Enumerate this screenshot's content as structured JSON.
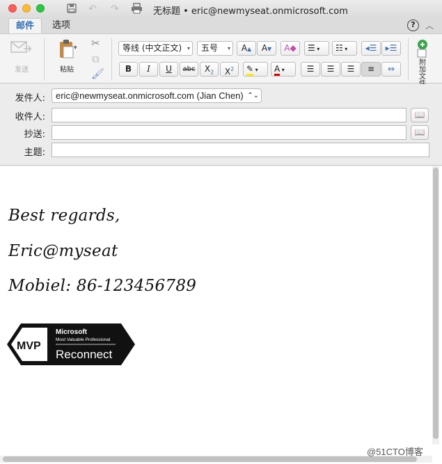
{
  "window": {
    "title": "无标题 • eric@newmyseat.onmicrosoft.com"
  },
  "tabs": [
    {
      "label": "邮件"
    },
    {
      "label": "选项"
    }
  ],
  "help_label": "?",
  "ribbon": {
    "send_label": "发送",
    "paste_label": "粘贴",
    "font_name": "等线 (中文正文)",
    "font_size": "五号",
    "attach_label": "附加文件"
  },
  "fields": {
    "from_label": "发件人:",
    "from_value": "eric@newmyseat.onmicrosoft.com (Jian Chen)",
    "to_label": "收件人:",
    "to_value": "",
    "cc_label": "抄送:",
    "cc_value": "",
    "subject_label": "主题:",
    "subject_value": ""
  },
  "body": {
    "signature_line1": "Best regards,",
    "signature_line2": "Eric@myseat",
    "signature_line3": "Mobiel: 86-123456789",
    "mvp_brand": "Microsoft",
    "mvp_tagline": "Most Valuable Professional",
    "mvp_word": "Reconnect",
    "mvp_mark": "MVP"
  },
  "watermark": "@51CTO博客"
}
